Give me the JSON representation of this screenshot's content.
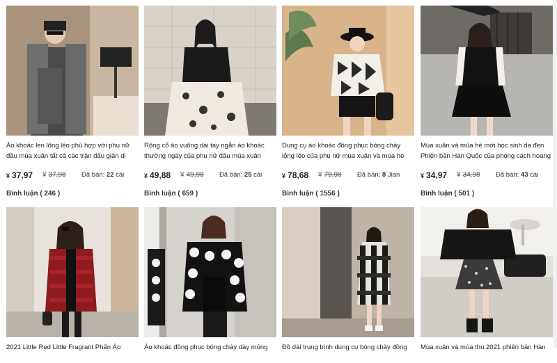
{
  "products": [
    {
      "title": "Áo khoác len lông léo phù hợp với phụ nữ đầu mùa xuân tất cả các trận đấu giản dị",
      "currency": "¥",
      "price": "37,97",
      "old_price": "37,98",
      "sold_label": "Đã bán:",
      "sold_value": "22",
      "sold_unit": "cái",
      "comments": "Bình luận ( 246 )"
    },
    {
      "title": "Rộng cổ áo vuông dài tay ngắn áo khoác thường ngày của phụ nữ đầu mùa xuân",
      "currency": "¥",
      "price": "49,88",
      "old_price": "49,98",
      "sold_label": "Đã bán:",
      "sold_value": "25",
      "sold_unit": "cái",
      "comments": "Bình luận ( 659 )"
    },
    {
      "title": "Dung cụ áo khoác đồng phục bóng chày lỏng lẻo của phụ nữ mùa xuân và mùa hè",
      "currency": "¥",
      "price": "78,68",
      "old_price": "79,98",
      "sold_label": "Đã bán:",
      "sold_value": "8",
      "sold_unit": "Jian",
      "comments": "Bình luận ( 1556 )"
    },
    {
      "title": "Mùa xuân và mùa hè mới học sinh da đen Phiên bản Hàn Quốc của phong cách hoang",
      "currency": "¥",
      "price": "34,97",
      "old_price": "34,98",
      "sold_label": "Đã bán:",
      "sold_value": "43",
      "sold_unit": "cái",
      "comments": "Bình luận ( 501 )"
    },
    {
      "title": "2021 Little Red Little Fragrant Phấn Áo"
    },
    {
      "title": "Áo khoác đồng phục bóng chày dày móng"
    },
    {
      "title": "Đồ dài trung bình dung cụ bóng chày đồng"
    },
    {
      "title": "Mùa xuân và mùa thu 2021 phiên bản Hàn"
    }
  ]
}
